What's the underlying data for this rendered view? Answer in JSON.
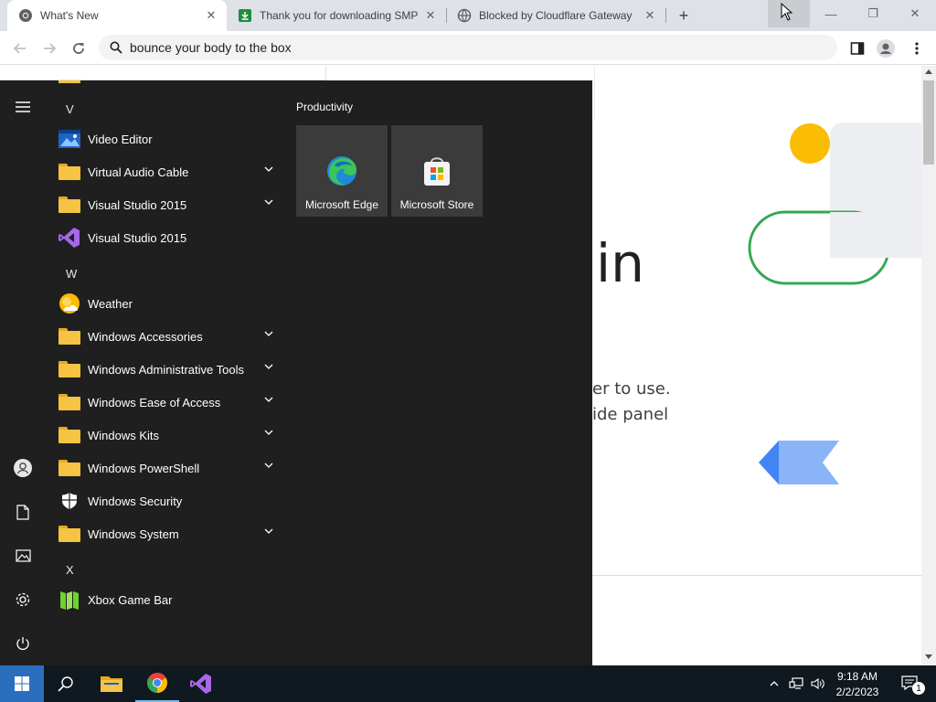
{
  "browser": {
    "tabs": [
      {
        "title": "What's New",
        "favicon": "chrome-icon",
        "active": true
      },
      {
        "title": "Thank you for downloading SMP",
        "favicon": "download-icon",
        "active": false
      },
      {
        "title": "Blocked by Cloudflare Gateway",
        "favicon": "globe-icon",
        "active": false
      }
    ],
    "new_tab_glyph": "+",
    "window_controls": {
      "minimize": "—",
      "restore": "❐",
      "close": "✕"
    },
    "address": {
      "value": "bounce your body to the box"
    }
  },
  "page": {
    "heading_fragment": "in",
    "text_line1": "er to use.",
    "text_line2": "ide panel"
  },
  "start_menu": {
    "sections": [
      {
        "letter": "V",
        "apps": [
          {
            "name": "Video Editor",
            "icon": "video-editor-icon",
            "expandable": false
          },
          {
            "name": "Virtual Audio Cable",
            "icon": "folder-icon",
            "expandable": true
          },
          {
            "name": "Visual Studio 2015",
            "icon": "folder-icon",
            "expandable": true
          },
          {
            "name": "Visual Studio 2015",
            "icon": "visual-studio-icon",
            "expandable": false
          }
        ]
      },
      {
        "letter": "W",
        "apps": [
          {
            "name": "Weather",
            "icon": "weather-icon",
            "expandable": false
          },
          {
            "name": "Windows Accessories",
            "icon": "folder-icon",
            "expandable": true
          },
          {
            "name": "Windows Administrative Tools",
            "icon": "folder-icon",
            "expandable": true
          },
          {
            "name": "Windows Ease of Access",
            "icon": "folder-icon",
            "expandable": true
          },
          {
            "name": "Windows Kits",
            "icon": "folder-icon",
            "expandable": true
          },
          {
            "name": "Windows PowerShell",
            "icon": "folder-icon",
            "expandable": true
          },
          {
            "name": "Windows Security",
            "icon": "shield-icon",
            "expandable": false
          },
          {
            "name": "Windows System",
            "icon": "folder-icon",
            "expandable": true
          }
        ]
      },
      {
        "letter": "X",
        "apps": [
          {
            "name": "Xbox Game Bar",
            "icon": "xbox-game-bar-icon",
            "expandable": false
          }
        ]
      }
    ],
    "tile_group": "Productivity",
    "tiles": [
      {
        "label": "Microsoft Edge",
        "icon": "edge-icon"
      },
      {
        "label": "Microsoft Store",
        "icon": "store-icon"
      }
    ],
    "rail": [
      "hamburger-icon",
      "user-icon",
      "documents-icon",
      "pictures-icon",
      "settings-icon",
      "power-icon"
    ]
  },
  "taskbar": {
    "pinned": [
      "start-icon",
      "search-icon",
      "file-explorer-icon",
      "chrome-icon",
      "visual-studio-icon"
    ],
    "clock": {
      "time": "9:18 AM",
      "date": "2/2/2023"
    },
    "notification_count": "1"
  }
}
